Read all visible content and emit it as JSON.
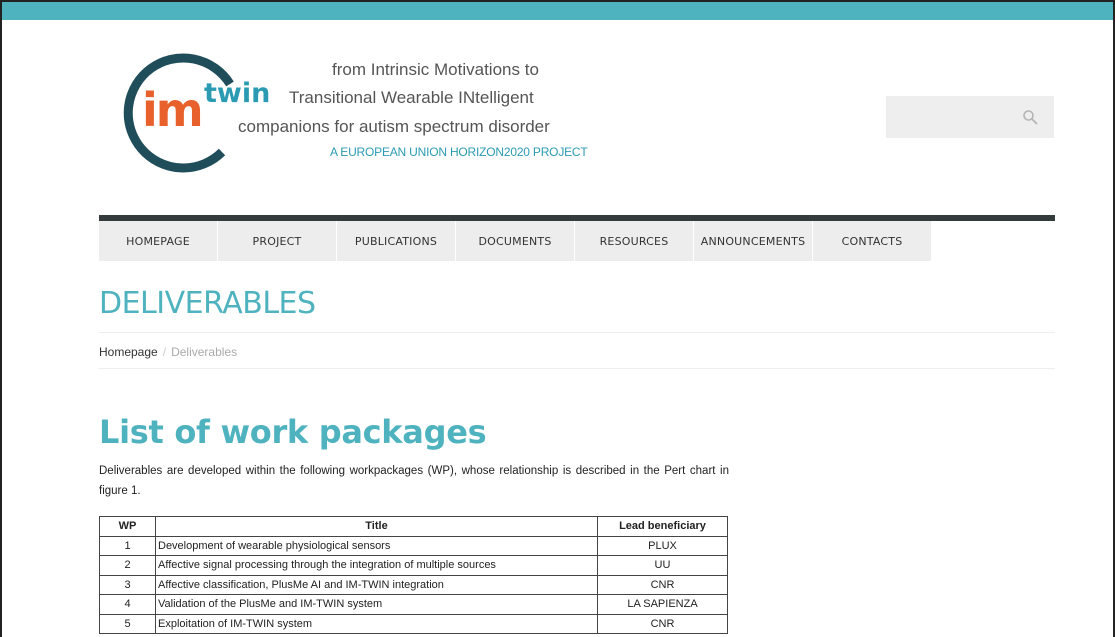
{
  "header": {
    "logo": {
      "im": "im",
      "twin": "twin",
      "tagline_line1": "from Intrinsic Motivations to",
      "tagline_line2": "Transitional Wearable INtelligent",
      "tagline_line3": "companions for autism spectrum disorder",
      "tagline_line4": "A EUROPEAN UNION HORIZON2020 PROJECT"
    },
    "search": {
      "placeholder": "",
      "icon": "search-icon"
    }
  },
  "nav": {
    "items": [
      {
        "label": "HOMEPAGE"
      },
      {
        "label": "PROJECT"
      },
      {
        "label": "PUBLICATIONS"
      },
      {
        "label": "DOCUMENTS"
      },
      {
        "label": "RESOURCES"
      },
      {
        "label": "ANNOUNCEMENTS"
      },
      {
        "label": "CONTACTS"
      }
    ]
  },
  "page": {
    "title": "DELIVERABLES",
    "breadcrumb": {
      "home": "Homepage",
      "divider": "/",
      "current": "Deliverables"
    }
  },
  "content": {
    "heading": "List of work packages",
    "intro": "Deliverables are developed within the following workpackages (WP), whose relationship is described in the Pert chart in figure 1.",
    "table": {
      "headers": [
        "WP",
        "Title",
        "Lead beneficiary"
      ],
      "rows": [
        {
          "wp": "1",
          "title": "Development of wearable physiological sensors",
          "lead": "PLUX"
        },
        {
          "wp": "2",
          "title": "Affective signal processing through the integration of multiple sources",
          "lead": "UU"
        },
        {
          "wp": "3",
          "title": "Affective classification, PlusMe AI and IM-TWIN integration",
          "lead": "CNR"
        },
        {
          "wp": "4",
          "title": "Validation of the PlusMe and IM-TWIN system",
          "lead": "LA SAPIENZA"
        },
        {
          "wp": "5",
          "title": "Exploitation of IM-TWIN system",
          "lead": "CNR"
        }
      ]
    }
  },
  "colors": {
    "accent": "#4fb3bf",
    "logo_orange": "#e8612c",
    "logo_arc": "#1f4e5a",
    "nav_bar": "#333b3d"
  }
}
